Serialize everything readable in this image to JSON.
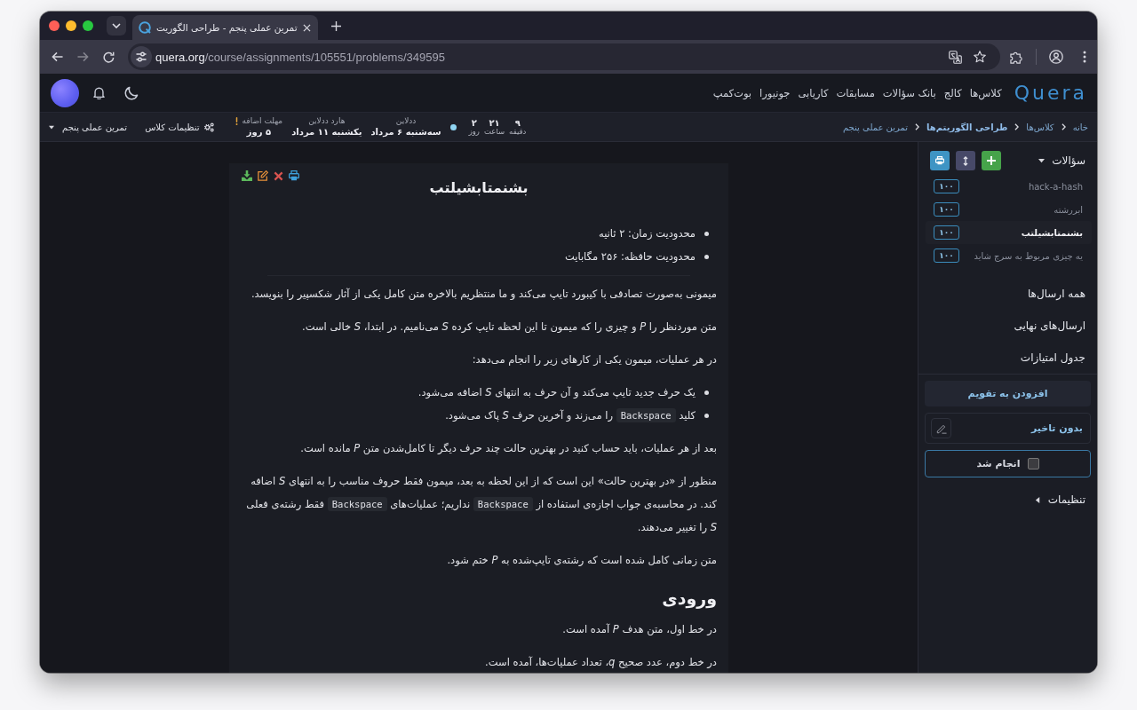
{
  "browser": {
    "tab_title": "تمرین عملی پنجم - طراحی الگوریت",
    "url_host": "quera.org",
    "url_path": "/course/assignments/105551/problems/349595"
  },
  "header": {
    "logo": "Quera",
    "nav": [
      "کلاس‌ها",
      "کالج",
      "بانک سؤالات",
      "مسابقات",
      "کاریابی",
      "جونیورا",
      "بوت‌کمپ"
    ]
  },
  "assignment_bar": {
    "breadcrumbs": [
      {
        "label": "خانه",
        "strong": false
      },
      {
        "label": "کلاس‌ها",
        "strong": false
      },
      {
        "label": "طراحی الگوریتم‌ها",
        "strong": true
      },
      {
        "label": "تمرین عملی پنجم",
        "strong": false
      }
    ],
    "countdown": [
      {
        "value": "۹",
        "unit": "دقیقه"
      },
      {
        "value": "۲۱",
        "unit": "ساعت"
      },
      {
        "value": "۲",
        "unit": "روز"
      }
    ],
    "deadlines": [
      {
        "label": "ددلاین",
        "value": "سه‌شنبه ۶ مرداد",
        "warning": false
      },
      {
        "label": "هارد ددلاین",
        "value": "یکشنبه ۱۱ مرداد",
        "warning": false
      },
      {
        "label": "مهلت اضافه",
        "value": "۵ روز",
        "warning": true
      }
    ],
    "class_settings": "تنظیمات کلاس",
    "assignment": "تمرین عملی پنجم"
  },
  "problem": {
    "title": "بشنمتابشیلتب",
    "limits": [
      "محدودیت زمان: ۲ ثانیه",
      "محدودیت حافظه: ۲۵۶ مگابایت"
    ],
    "blocks": [
      {
        "kind": "paragraph",
        "parts": [
          {
            "kind": "text",
            "text": "میمونی به‌صورت تصادفی با کیبورد تایپ می‌کند و ما منتظریم بالاخره متن کامل یکی از آثار شکسپیر را بنویسد."
          }
        ]
      },
      {
        "kind": "paragraph",
        "parts": [
          {
            "kind": "text",
            "text": "متن موردنظر را *P* و چیزی را که میمون تا این لحظه تایپ کرده *S* می‌نامیم. در ابتدا، *S* خالی است."
          }
        ]
      },
      {
        "kind": "paragraph",
        "parts": [
          {
            "kind": "text",
            "text": "در هر عملیات، میمون یکی از کارهای زیر را انجام می‌دهد:"
          }
        ]
      },
      {
        "kind": "list",
        "items": [
          {
            "parts": [
              {
                "kind": "text",
                "text": "یک حرف جدید تایپ می‌کند و آن حرف به انتهای *S* اضافه می‌شود."
              }
            ]
          },
          {
            "parts": [
              {
                "kind": "text",
                "text": "کلید "
              },
              {
                "kind": "code",
                "text": "Backspace"
              },
              {
                "kind": "text",
                "text": " را می‌زند و آخرین حرف *S* پاک می‌شود."
              }
            ]
          }
        ]
      },
      {
        "kind": "paragraph",
        "parts": [
          {
            "kind": "text",
            "text": "بعد از هر عملیات، باید حساب کنید در بهترین حالت چند حرف دیگر تا کامل‌شدن متن *P* مانده است."
          }
        ]
      },
      {
        "kind": "paragraph",
        "parts": [
          {
            "kind": "text",
            "text": "منظور از «در بهترین حالت» این است که از این لحظه به بعد، میمون فقط حروف مناسب را به انتهای *S* اضافه کند. در محاسبه‌ی جواب اجازه‌ی استفاده از "
          },
          {
            "kind": "code",
            "text": "Backspace"
          },
          {
            "kind": "text",
            "text": " نداریم؛ عملیات‌های "
          },
          {
            "kind": "code",
            "text": "Backspace"
          },
          {
            "kind": "text",
            "text": " فقط رشته‌ی فعلی *S* را تغییر می‌دهند."
          }
        ]
      },
      {
        "kind": "paragraph",
        "parts": [
          {
            "kind": "text",
            "text": "متن زمانی کامل شده است که رشته‌ی تایپ‌شده به *P* ختم شود."
          }
        ]
      },
      {
        "kind": "heading",
        "text": "ورودی"
      },
      {
        "kind": "paragraph",
        "parts": [
          {
            "kind": "text",
            "text": "در خط اول، متن هدف *P* آمده است."
          }
        ]
      },
      {
        "kind": "paragraph",
        "parts": [
          {
            "kind": "text",
            "text": "در خط دوم، عدد صحیح *q*، تعداد عملیات‌ها، آمده است."
          }
        ]
      }
    ]
  },
  "sidebar": {
    "questions": {
      "title": "سؤالات",
      "expanded": true,
      "items": [
        {
          "name": "hack-a-hash",
          "score": "۱۰۰",
          "selected": false
        },
        {
          "name": "ابررشته",
          "score": "۱۰۰",
          "selected": false
        },
        {
          "name": "بشنمتابشیلتب",
          "score": "۱۰۰",
          "selected": true
        },
        {
          "name": "یه چیزی مربوط به سرچ شاید",
          "score": "۱۰۰",
          "selected": false
        }
      ]
    },
    "links": [
      "همه ارسال‌ها",
      "ارسال‌های نهایی",
      "جدول امتیازات"
    ],
    "calendar_button": "افزودن به تقویم",
    "delay_status": "بدون تاخیر",
    "done": {
      "label": "انجام شد",
      "checked": false
    },
    "settings": {
      "title": "تنظیمات",
      "expanded": false
    }
  }
}
